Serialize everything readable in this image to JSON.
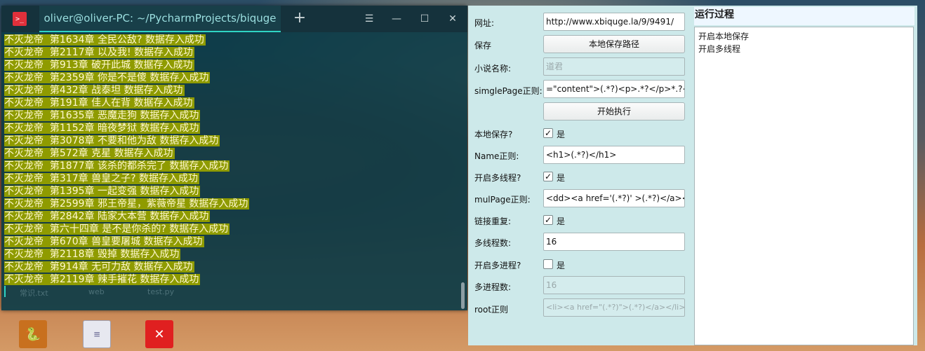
{
  "terminal": {
    "title": "oliver@oliver-PC: ~/PycharmProjects/biquge",
    "lines": [
      "不灭龙帝  第1634章 全民公敌? 数据存入成功",
      "不灭龙帝  第2117章 以及我! 数据存入成功",
      "不灭龙帝  第913章 破开此城 数据存入成功",
      "不灭龙帝  第2359章 你是不是傻 数据存入成功",
      "不灭龙帝  第432章 战泰坦 数据存入成功",
      "不灭龙帝  第191章 佳人在背 数据存入成功",
      "不灭龙帝  第1635章 恶魔走狗 数据存入成功",
      "不灭龙帝  第1152章 暗夜梦狱 数据存入成功",
      "不灭龙帝  第3078章 不要和他为敌 数据存入成功",
      "不灭龙帝  第572章 克星 数据存入成功",
      "不灭龙帝  第1877章 该杀的都杀完了 数据存入成功",
      "不灭龙帝  第317章 兽皇之子? 数据存入成功",
      "不灭龙帝  第1395章 一起变强 数据存入成功",
      "不灭龙帝  第2599章 邪王帝星，紫薇帝星 数据存入成功",
      "不灭龙帝  第2842章 陆家大本营 数据存入成功",
      "不灭龙帝  第六十四章 是不是你杀的? 数据存入成功",
      "不灭龙帝  第670章 兽皇要屠城 数据存入成功",
      "不灭龙帝  第2118章 毁掉 数据存入成功",
      "不灭龙帝  第914章 无可力敌 数据存入成功",
      "不灭龙帝  第2119章 辣手摧花 数据存入成功"
    ],
    "ghost_files": [
      "常识.txt",
      "web",
      "test.py"
    ]
  },
  "desktop": {
    "icons": [
      "python-file-icon",
      "text-file-icon",
      "xmind-icon"
    ]
  },
  "app": {
    "url_label": "网址:",
    "url_value": "http://www.xbiquge.la/9/9491/",
    "save_label": "保存",
    "save_path_button": "本地保存路径",
    "novel_name_label": "小说名称:",
    "novel_name_placeholder": "道君",
    "single_page_label": "simglePage正则:",
    "single_page_value": "=\"content\">(.*?)<p>.*?</p>*.?</div>",
    "start_button": "开始执行",
    "local_save_label": "本地保存?",
    "local_save_checked": true,
    "yes": "是",
    "name_regex_label": "Name正则:",
    "name_regex_value": "<h1>(.*?)</h1>",
    "multi_thread_label": "开启多线程?",
    "multi_thread_checked": true,
    "mul_page_label": "mulPage正则:",
    "mul_page_value": "<dd><a href='(.*?)' >(.*?)</a></dd>",
    "link_repeat_label": "链接重复:",
    "link_repeat_checked": true,
    "thread_count_label": "多线程数:",
    "thread_count_value": "16",
    "multi_process_label": "开启多进程?",
    "multi_process_checked": false,
    "process_count_label": "多进程数:",
    "process_count_placeholder": "16",
    "root_regex_label": "root正则",
    "root_regex_placeholder": "<li><a href=\"(.*?)\">(.*?)</a></li>",
    "process_title": "运行过程",
    "process_log": [
      "开启本地保存",
      "开启多线程"
    ]
  }
}
